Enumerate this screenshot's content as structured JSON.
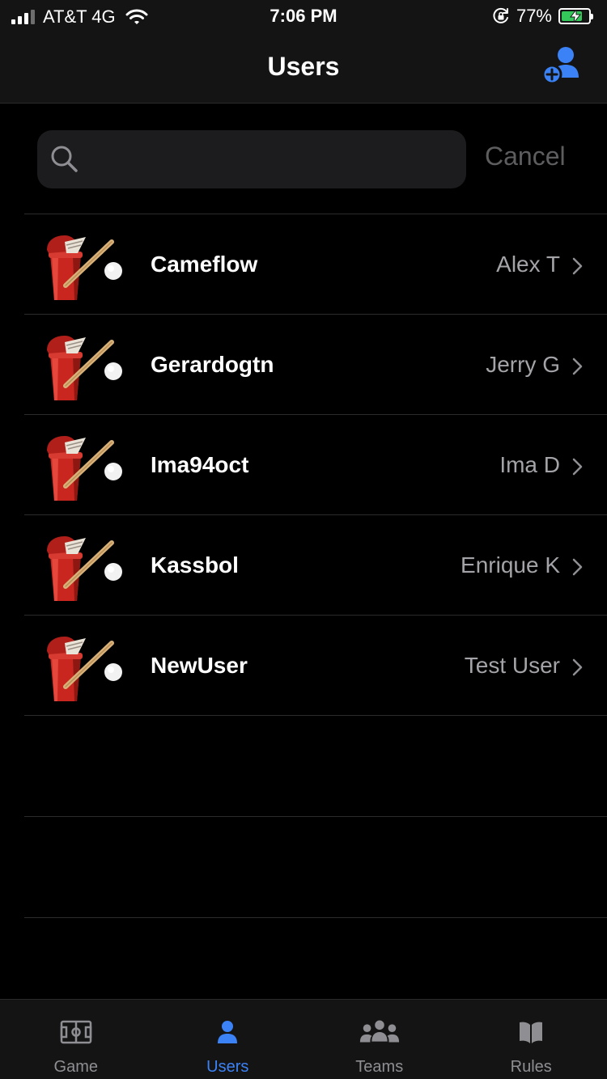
{
  "status_bar": {
    "carrier": "AT&T 4G",
    "time": "7:06 PM",
    "battery_pct": "77%",
    "battery_level": 0.77
  },
  "nav": {
    "title": "Users",
    "add_icon": "add-user-icon"
  },
  "search": {
    "value": "",
    "placeholder": "",
    "cancel_label": "Cancel"
  },
  "users": [
    {
      "username": "Cameflow",
      "name": "Alex T"
    },
    {
      "username": "Gerardogtn",
      "name": "Jerry G"
    },
    {
      "username": "Ima94oct",
      "name": "Ima D"
    },
    {
      "username": "Kassbol",
      "name": "Enrique K"
    },
    {
      "username": "NewUser",
      "name": "Test User"
    }
  ],
  "tabs": [
    {
      "label": "Game",
      "icon": "field-icon",
      "active": false
    },
    {
      "label": "Users",
      "icon": "person-icon",
      "active": true
    },
    {
      "label": "Teams",
      "icon": "group-icon",
      "active": false
    },
    {
      "label": "Rules",
      "icon": "book-icon",
      "active": false
    }
  ],
  "colors": {
    "accent": "#3b82f6",
    "background": "#000000",
    "bar_background": "#141414",
    "secondary_text": "#a3a3a8",
    "battery": "#34c759"
  }
}
